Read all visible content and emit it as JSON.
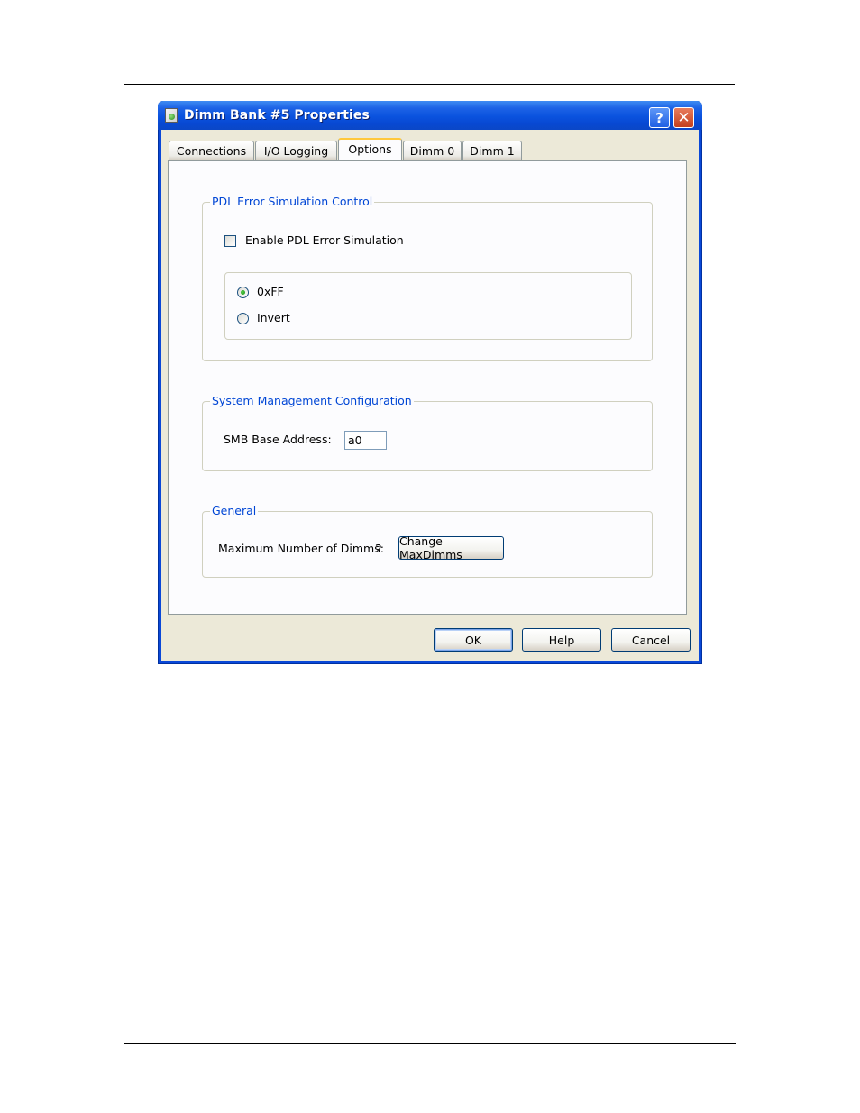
{
  "window": {
    "title": "Dimm Bank #5 Properties",
    "help_glyph": "?",
    "close_glyph": "✕",
    "icons": {
      "app": "dimm-bank-app-icon",
      "help": "question-icon",
      "close": "close-icon"
    }
  },
  "tabs": [
    {
      "label": "Connections",
      "active": false
    },
    {
      "label": "I/O Logging",
      "active": false
    },
    {
      "label": "Options",
      "active": true
    },
    {
      "label": "Dimm 0",
      "active": false
    },
    {
      "label": "Dimm 1",
      "active": false
    }
  ],
  "pdl_group": {
    "title": "PDL Error Simulation Control",
    "enable_label": "Enable PDL Error Simulation",
    "enable_checked": false,
    "options": [
      {
        "label": "0xFF",
        "selected": true
      },
      {
        "label": "Invert",
        "selected": false
      }
    ]
  },
  "smb_group": {
    "title": "System Management Configuration",
    "base_address_label": "SMB Base Address:",
    "base_address_value": "a0"
  },
  "general_group": {
    "title": "General",
    "max_dimms_label": "Maximum Number of Dimms:",
    "max_dimms_value": "2",
    "change_button": "Change MaxDimms"
  },
  "buttons": {
    "ok": "OK",
    "help": "Help",
    "cancel": "Cancel"
  },
  "colors": {
    "title_bar": "#0a52de",
    "dialog_face": "#ece9d8",
    "group_title": "#0046d5",
    "tab_highlight": "#ffc83c"
  }
}
